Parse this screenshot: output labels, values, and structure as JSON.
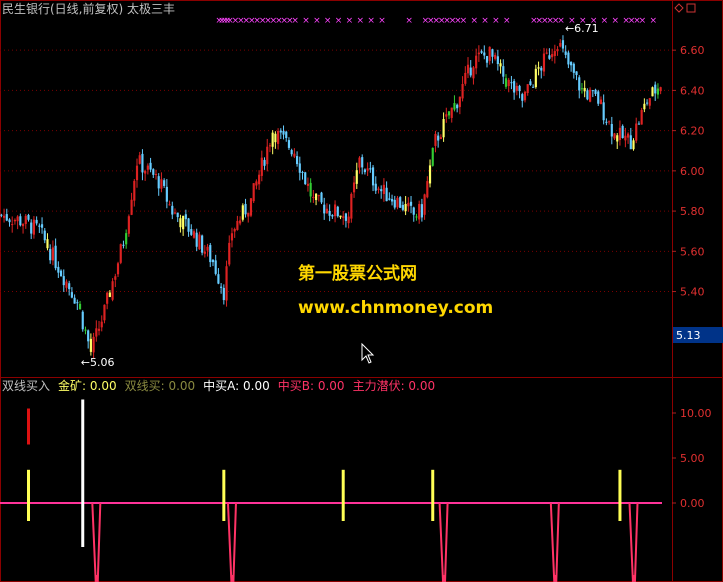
{
  "header": {
    "title": "民生银行(日线,前复权) 太极三丰"
  },
  "watermark": {
    "line1": "第一股票公式网",
    "line2": "www.chnmoney.com"
  },
  "indicator_legend": [
    {
      "label": "双线买入",
      "color": "#c0c0c0"
    },
    {
      "label": "金矿: 0.00",
      "color": "#ffff66"
    },
    {
      "label": "双线买: 0.00",
      "color": "#8a8a40"
    },
    {
      "label": "中买A: 0.00",
      "color": "#ffffff"
    },
    {
      "label": "中买B: 0.00",
      "color": "#ff3366"
    },
    {
      "label": "主力潜伏: 0.00",
      "color": "#ff3366"
    }
  ],
  "chart_data": [
    {
      "type": "candlestick",
      "name": "price",
      "ylim": [
        5.0,
        6.75
      ],
      "y_ticks": [
        "6.60",
        "6.40",
        "6.20",
        "6.00",
        "5.80",
        "5.60",
        "5.40"
      ],
      "last_price_label": "5.13",
      "annotations": [
        {
          "text": "←5.06",
          "value": 5.06,
          "bar": 30
        },
        {
          "text": "←6.71",
          "value": 6.71,
          "bar": 207
        }
      ],
      "bar_count": 244,
      "close_path": [
        [
          0,
          5.78
        ],
        [
          8,
          5.75
        ],
        [
          14,
          5.7
        ],
        [
          20,
          5.55
        ],
        [
          28,
          5.35
        ],
        [
          33,
          5.1
        ],
        [
          38,
          5.3
        ],
        [
          45,
          5.65
        ],
        [
          50,
          6.05
        ],
        [
          58,
          5.95
        ],
        [
          63,
          5.8
        ],
        [
          70,
          5.7
        ],
        [
          78,
          5.55
        ],
        [
          82,
          5.4
        ],
        [
          85,
          5.7
        ],
        [
          92,
          5.85
        ],
        [
          100,
          6.2
        ],
        [
          108,
          6.1
        ],
        [
          115,
          5.85
        ],
        [
          122,
          5.8
        ],
        [
          128,
          5.78
        ],
        [
          132,
          6.05
        ],
        [
          140,
          5.9
        ],
        [
          146,
          5.85
        ],
        [
          152,
          5.78
        ],
        [
          155,
          5.8
        ],
        [
          160,
          6.15
        ],
        [
          168,
          6.35
        ],
        [
          174,
          6.55
        ],
        [
          180,
          6.58
        ],
        [
          186,
          6.45
        ],
        [
          192,
          6.35
        ],
        [
          198,
          6.5
        ],
        [
          205,
          6.65
        ],
        [
          208,
          6.55
        ],
        [
          214,
          6.4
        ],
        [
          220,
          6.35
        ],
        [
          226,
          6.18
        ],
        [
          232,
          6.15
        ],
        [
          238,
          6.35
        ],
        [
          244,
          6.45
        ]
      ],
      "marker_row": {
        "symbol": "×",
        "color": "#ff44ff",
        "bars": [
          80,
          81,
          82,
          83,
          84,
          86,
          88,
          90,
          92,
          94,
          96,
          98,
          100,
          102,
          104,
          106,
          108,
          112,
          116,
          120,
          124,
          128,
          132,
          136,
          140,
          150,
          156,
          158,
          160,
          162,
          164,
          166,
          168,
          170,
          174,
          178,
          182,
          186,
          196,
          198,
          200,
          202,
          204,
          206,
          210,
          214,
          218,
          222,
          226,
          230,
          232,
          234,
          236,
          240
        ]
      }
    },
    {
      "type": "bar",
      "name": "indicator",
      "ylim": [
        -15,
        15
      ],
      "y_ticks": [
        "10.00",
        "5.00",
        "0.00"
      ],
      "baseline": 0,
      "series": [
        {
          "name": "金矿",
          "color": "#ffff55",
          "marks": [
            {
              "bar": 10,
              "value": 1.8
            },
            {
              "bar": 82,
              "value": 1.8
            },
            {
              "bar": 126,
              "value": 1.8
            },
            {
              "bar": 159,
              "value": 1.8
            },
            {
              "bar": 228,
              "value": 1.8
            }
          ]
        },
        {
          "name": "中买A",
          "color": "#ffffff",
          "marks": [
            {
              "bar": 30,
              "value": 11.5
            }
          ]
        },
        {
          "name": "中买B",
          "color": "#ff3366",
          "marks": [
            {
              "bar": 35,
              "value": -8
            },
            {
              "bar": 85,
              "value": -8
            },
            {
              "bar": 163,
              "value": -8
            },
            {
              "bar": 204,
              "value": -8
            },
            {
              "bar": 233,
              "value": -8
            }
          ]
        },
        {
          "name": "主力潜伏",
          "color": "#dd1111",
          "marks": [
            {
              "bar": 10,
              "value": 8.5,
              "top": 10.5
            }
          ]
        }
      ]
    }
  ]
}
